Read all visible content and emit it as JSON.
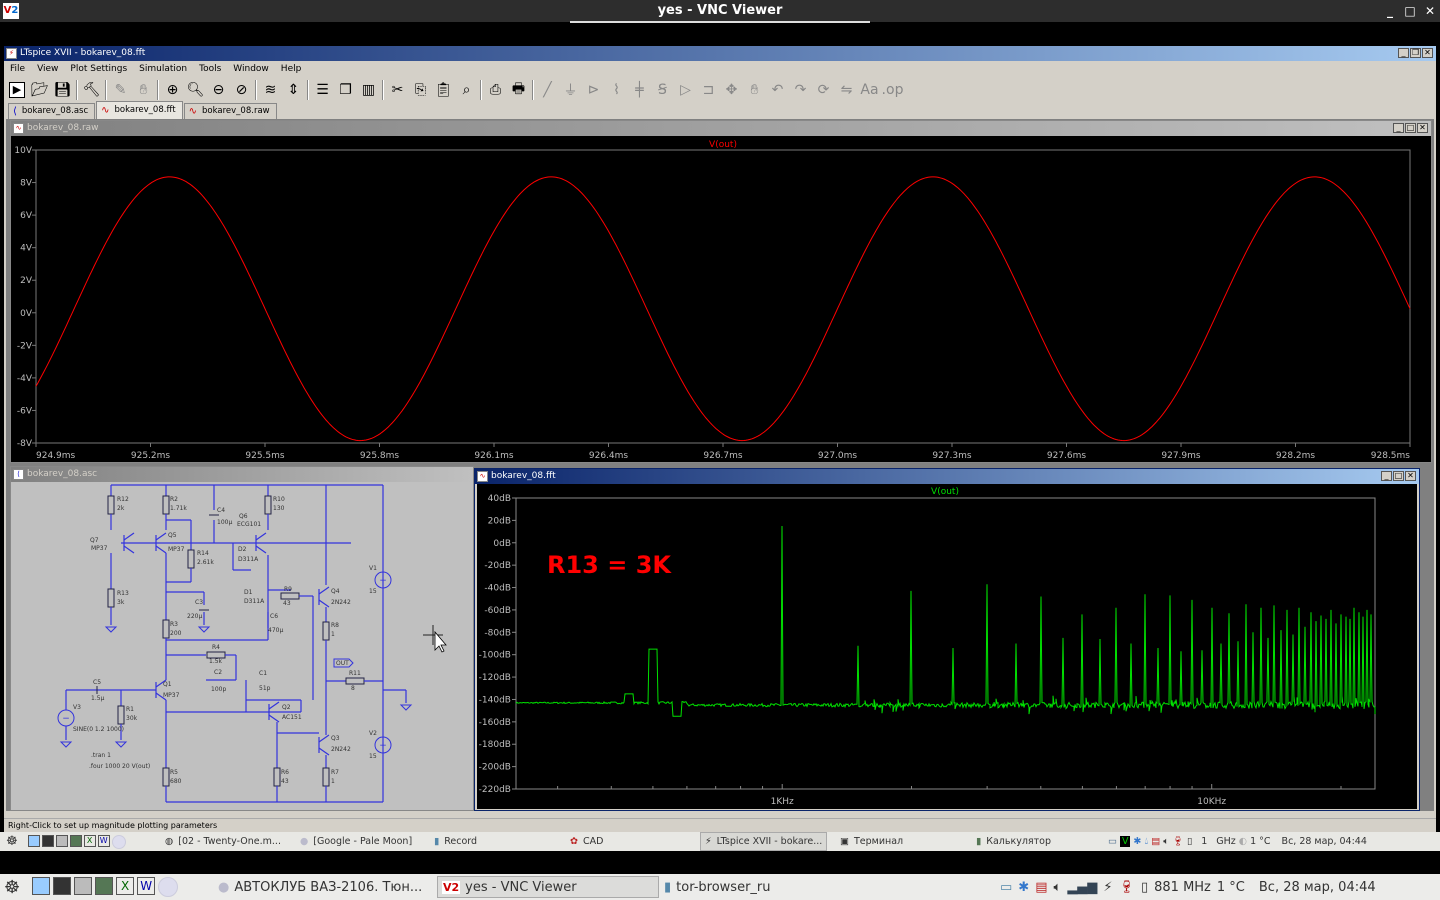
{
  "vnc": {
    "title": "yes - VNC Viewer",
    "logo": "V2"
  },
  "ltspice": {
    "title": "LTspice XVII - bokarev_08.fft",
    "menu": [
      "File",
      "View",
      "Plot Settings",
      "Simulation",
      "Tools",
      "Window",
      "Help"
    ],
    "toolbar": [
      "run",
      "open",
      "save",
      "|",
      "control-panel",
      "|",
      "probe",
      "halt",
      "|",
      "zoom-in",
      "zoom-full",
      "zoom-out",
      "zoom-cancel",
      "|",
      "autorange",
      "manual-limits",
      "|",
      "tile-horizontal",
      "cascade",
      "tile-vertical",
      "|",
      "cut",
      "copy",
      "paste",
      "find",
      "|",
      "print-preview",
      "print",
      "|",
      "draw-wire",
      "ground",
      "label-net",
      "resistor",
      "capacitor",
      "inductor",
      "diode",
      "component",
      "move",
      "drag",
      "undo",
      "redo",
      "rotate",
      "mirror",
      "text",
      "spice-directive"
    ],
    "tabs": [
      {
        "label": "bokarev_08.asc",
        "selected": false
      },
      {
        "label": "bokarev_08.fft",
        "selected": true
      },
      {
        "label": "bokarev_08.raw",
        "selected": false
      }
    ],
    "status": "Right-Click to set up magnitude plotting parameters"
  },
  "raw_window": {
    "title": "bokarev_08.raw"
  },
  "asc_window": {
    "title": "bokarev_08.asc"
  },
  "fft_window": {
    "title": "bokarev_08.fft",
    "annotation": "R13 = 3K",
    "annotation_color": "#ff0000"
  },
  "schematic": {
    "components": [
      {
        "ref": "R12",
        "value": "2k"
      },
      {
        "ref": "R2",
        "value": "1.71k"
      },
      {
        "ref": "C4",
        "value": "100µ"
      },
      {
        "ref": "Q6",
        "value": "ECG101"
      },
      {
        "ref": "R10",
        "value": "130"
      },
      {
        "ref": "Q7",
        "value": "MP37"
      },
      {
        "ref": "Q5",
        "value": "MP37"
      },
      {
        "ref": "R14",
        "value": "2.61k"
      },
      {
        "ref": "D2",
        "value": "D311A"
      },
      {
        "ref": "R13",
        "value": "3k"
      },
      {
        "ref": "C3",
        "value": "220µ"
      },
      {
        "ref": "D1",
        "value": "D311A"
      },
      {
        "ref": "R9",
        "value": "43"
      },
      {
        "ref": "Q4",
        "value": "2N242"
      },
      {
        "ref": "R3",
        "value": "200"
      },
      {
        "ref": "C6",
        "value": "470µ"
      },
      {
        "ref": "R8",
        "value": "1"
      },
      {
        "ref": "V1",
        "value": "15"
      },
      {
        "ref": "R4",
        "value": "1.5k"
      },
      {
        "ref": "C2",
        "value": "100p"
      },
      {
        "ref": "C1",
        "value": "51p"
      },
      {
        "ref": "R11",
        "value": "8"
      },
      {
        "ref": "C5",
        "value": "1.5µ"
      },
      {
        "ref": "Q1",
        "value": "MP37"
      },
      {
        "ref": "V3",
        "value": "SINE(0 1.2 1000)"
      },
      {
        "ref": "R1",
        "value": "30k"
      },
      {
        "ref": "Q2",
        "value": "AC151"
      },
      {
        "ref": "Q3",
        "value": "2N242"
      },
      {
        "ref": "V2",
        "value": "15"
      },
      {
        "ref": "R5",
        "value": "680"
      },
      {
        "ref": "R6",
        "value": "43"
      },
      {
        "ref": "R7",
        "value": "1"
      }
    ],
    "net_label": "OUT",
    "directives": [
      ".tran 1",
      ".four 1000 20 V(out)"
    ]
  },
  "chart_data": [
    {
      "type": "line",
      "title": "V(out)",
      "trace_color": "#ff0000",
      "xlim": [
        924.9,
        928.5
      ],
      "ylim": [
        -8,
        10
      ],
      "x_unit": "ms",
      "y_unit": "V",
      "x_ticks": [
        "924.9ms",
        "925.2ms",
        "925.5ms",
        "925.8ms",
        "926.1ms",
        "926.4ms",
        "926.7ms",
        "927.0ms",
        "927.3ms",
        "927.6ms",
        "927.9ms",
        "928.2ms",
        "928.5ms"
      ],
      "y_ticks": [
        "10V",
        "8V",
        "6V",
        "4V",
        "2V",
        "0V",
        "-2V",
        "-4V",
        "-6V",
        "-8V"
      ],
      "waveform": {
        "shape": "sine",
        "frequency_hz": 1000,
        "amplitude_v": 8.1,
        "offset_v": 0.25,
        "peaks_ms": [
          925.25,
          926.25,
          927.25,
          928.25
        ],
        "troughs_ms": [
          925.75,
          926.75,
          927.75
        ]
      }
    },
    {
      "type": "line",
      "title": "V(out)",
      "trace_color": "#00e000",
      "x_scale": "log",
      "xlim_hz": [
        240,
        24000
      ],
      "ylim": [
        -220,
        40
      ],
      "y_unit": "dB",
      "x_ticks": [
        "1KHz",
        "10KHz"
      ],
      "y_ticks": [
        "40dB",
        "20dB",
        "0dB",
        "-20dB",
        "-40dB",
        "-60dB",
        "-80dB",
        "-100dB",
        "-120dB",
        "-140dB",
        "-160dB",
        "-180dB",
        "-200dB",
        "-220dB"
      ],
      "noise_floor_db": -145,
      "peaks": [
        {
          "f": 440,
          "db": -135
        },
        {
          "f": 500,
          "db": -95
        },
        {
          "f": 570,
          "db": -155
        },
        {
          "f": 1000,
          "db": 15
        },
        {
          "f": 1500,
          "db": -92
        },
        {
          "f": 2000,
          "db": -43
        },
        {
          "f": 2500,
          "db": -94
        },
        {
          "f": 3000,
          "db": -37
        },
        {
          "f": 3500,
          "db": -90
        },
        {
          "f": 4000,
          "db": -48
        },
        {
          "f": 4500,
          "db": -85
        },
        {
          "f": 5000,
          "db": -64
        },
        {
          "f": 5500,
          "db": -86
        },
        {
          "f": 6000,
          "db": -58
        },
        {
          "f": 6500,
          "db": -90
        },
        {
          "f": 7000,
          "db": -46
        },
        {
          "f": 7500,
          "db": -94
        },
        {
          "f": 8000,
          "db": -47
        },
        {
          "f": 8500,
          "db": -97
        },
        {
          "f": 9000,
          "db": -51
        },
        {
          "f": 9500,
          "db": -96
        },
        {
          "f": 10000,
          "db": -58
        },
        {
          "f": 10500,
          "db": -90
        },
        {
          "f": 11000,
          "db": -63
        },
        {
          "f": 11500,
          "db": -88
        },
        {
          "f": 12000,
          "db": -55
        },
        {
          "f": 12500,
          "db": -80
        },
        {
          "f": 13000,
          "db": -58
        },
        {
          "f": 13500,
          "db": -85
        },
        {
          "f": 14000,
          "db": -56
        },
        {
          "f": 14500,
          "db": -78
        },
        {
          "f": 15000,
          "db": -60
        },
        {
          "f": 15500,
          "db": -82
        },
        {
          "f": 16000,
          "db": -58
        },
        {
          "f": 16500,
          "db": -75
        },
        {
          "f": 17000,
          "db": -62
        },
        {
          "f": 17500,
          "db": -70
        },
        {
          "f": 18000,
          "db": -65
        },
        {
          "f": 18500,
          "db": -68
        },
        {
          "f": 19000,
          "db": -60
        },
        {
          "f": 19500,
          "db": -72
        },
        {
          "f": 20000,
          "db": -64
        },
        {
          "f": 20500,
          "db": -66
        },
        {
          "f": 21000,
          "db": -68
        },
        {
          "f": 21500,
          "db": -58
        },
        {
          "f": 22000,
          "db": -62
        },
        {
          "f": 22500,
          "db": -66
        },
        {
          "f": 23000,
          "db": -60
        },
        {
          "f": 23500,
          "db": -64
        }
      ]
    }
  ],
  "inner_taskbar": {
    "items": [
      "[02 - Twenty-One.m...",
      "[Google - Pale Moon]",
      "Record",
      "CAD",
      "LTspice XVII - bokare...",
      "Терминал",
      "Калькулятор"
    ],
    "tray": {
      "cpu": "1",
      "cpu_unit": "GHz",
      "temp": "1 °C",
      "clock": "Вс, 28 мар, 04:44"
    }
  },
  "outer_taskbar": {
    "items": [
      "АВТОКЛУБ ВАЗ-2106. Тюн...",
      "yes - VNC Viewer",
      "tor-browser_ru"
    ],
    "tray": {
      "cpu": "881 MHz",
      "temp": "1 °C",
      "clock": "Вс, 28 мар, 04:44"
    }
  }
}
